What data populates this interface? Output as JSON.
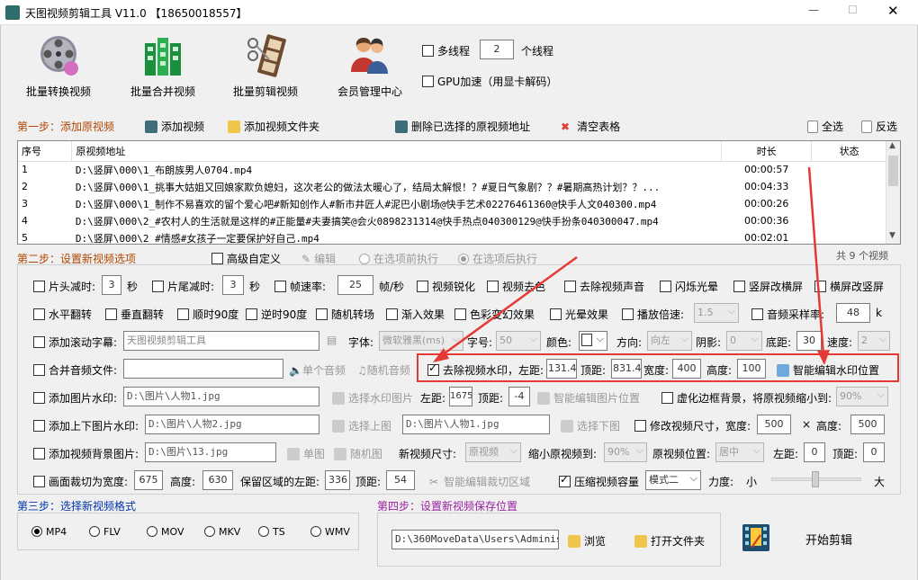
{
  "window": {
    "title": "天图视频剪辑工具 V11.0  【18650018557】",
    "minimize": "—",
    "maximize": "☐",
    "close": "✕"
  },
  "toolbar": {
    "items": [
      {
        "label": "批量转换视频"
      },
      {
        "label": "批量合并视频"
      },
      {
        "label": "批量剪辑视频"
      },
      {
        "label": "会员管理中心"
      }
    ],
    "multithread_label": "多线程",
    "thread_count": "2",
    "thread_unit": "个线程",
    "gpu_label": "GPU加速（用显卡解码）"
  },
  "step1": {
    "title": "第一步：添加原视频",
    "add_video": "添加视频",
    "add_folder": "添加视频文件夹",
    "delete_selected": "删除已选择的原视频地址",
    "clear_table": "清空表格",
    "select_all": "全选",
    "invert": "反选",
    "columns": [
      "序号",
      "原视频地址",
      "时长",
      "状态"
    ],
    "rows": [
      {
        "no": "1",
        "path": "D:\\竖屏\\000\\1_布朗族男人0704.mp4",
        "duration": "00:00:57",
        "status": ""
      },
      {
        "no": "2",
        "path": "D:\\竖屏\\000\\1_挑事大姑姐又回娘家欺负媳妇，这次老公的做法太暖心了，结局太解恨！？#夏日气象剧？？#暑期高热计划？？...",
        "duration": "00:04:33",
        "status": ""
      },
      {
        "no": "3",
        "path": "D:\\竖屏\\000\\1_制作不易喜欢的留个爱心吧#新知创作人#新市井匠人#泥巴小剧场@快手艺术02276461360@快手人文040300.mp4",
        "duration": "00:00:26",
        "status": ""
      },
      {
        "no": "4",
        "path": "D:\\竖屏\\000\\2_#农村人的生活就是这样的#正能量#夫妻搞笑@会火0898231314@快手热点040300129@快手扮条040300047.mp4",
        "duration": "00:00:36",
        "status": ""
      },
      {
        "no": "5",
        "path": "D:\\竖屏\\000\\2_#情感#女孩子一定要保护好自己.mp4",
        "duration": "00:02:01",
        "status": ""
      }
    ],
    "total": "共 9 个视频"
  },
  "step2": {
    "title": "第二步：设置新视频选项",
    "advanced": "高级自定义",
    "edit": "编辑",
    "before": "在选项前执行",
    "after": "在选项后执行",
    "head_trim": "片头减时:",
    "head_val": "3",
    "sec": "秒",
    "tail_trim": "片尾减时:",
    "tail_val": "3",
    "sec2": "秒",
    "fps_label": "帧速率:",
    "fps_val": "25",
    "fps_unit": "帧/秒",
    "sharpen": "视频锐化",
    "decolor": "视频去色",
    "remove_audio": "去除视频声音",
    "flash": "闪烁光晕",
    "v2h": "竖屏改横屏",
    "h2v": "横屏改竖屏",
    "hflip": "水平翻转",
    "vflip": "垂直翻转",
    "rot90cw": "顺时90度",
    "rot90ccw": "逆时90度",
    "random_trans": "随机转场",
    "fade_in": "渐入效果",
    "color_fx": "色彩变幻效果",
    "light_fx": "光晕效果",
    "speed_label": "播放倍速:",
    "speed_val": "1.5",
    "sample_label": "音频采样率:",
    "sample_val": "48",
    "sample_unit": "k",
    "scroll_sub": "添加滚动字幕:",
    "scroll_text": "天图视频剪辑工具",
    "font_label": "字体:",
    "font_val": "微软雅黑(ms)",
    "size_label": "字号:",
    "size_val": "50",
    "color_label": "颜色:",
    "dir_label": "方向:",
    "dir_val": "向左",
    "shadow_label": "阴影:",
    "shadow_val": "0",
    "bottom_label": "底距:",
    "bottom_val": "30",
    "speed2_label": "速度:",
    "speed2_val": "2",
    "merge_audio": "合并音频文件:",
    "single_audio": "单个音频",
    "random_audio": "随机音频",
    "remove_wm": "去除视频水印，左距:",
    "wm_left": "131.4",
    "wm_top_label": "顶距:",
    "wm_top": "831.4",
    "wm_w_label": "宽度:",
    "wm_w": "400",
    "wm_h_label": "高度:",
    "wm_h": "100",
    "smart_wm": "智能编辑水印位置",
    "img_wm": "添加图片水印:",
    "img_wm_path": "D:\\图片\\人物1.jpg",
    "sel_wm_img": "选择水印图片",
    "img_left_label": "左距:",
    "img_left": "1675",
    "img_top_label": "顶距:",
    "img_top": "-4",
    "smart_img": "智能编辑图片位置",
    "blur_bg": "虚化边框背景，将原视频缩小到:",
    "blur_val": "90%",
    "tb_img": "添加上下图片水印:",
    "top_img_path": "D:\\图片\\人物2.jpg",
    "sel_top": "选择上图",
    "bottom_img_path": "D:\\图片\\人物1.jpg",
    "sel_bottom": "选择下图",
    "resize": "修改视频尺寸，宽度:",
    "resize_w": "500",
    "times": "×",
    "resize_h_label": "高度:",
    "resize_h": "500",
    "bg_img": "添加视频背景图片:",
    "bg_path": "D:\\图片\\13.jpg",
    "single_img": "单图",
    "random_img": "随机图",
    "new_size": "新视频尺寸:",
    "new_size_val": "原视频",
    "shrink": "缩小原视频到:",
    "shrink_val": "90%",
    "pos": "原视频位置:",
    "pos_val": "居中",
    "left_label": "左距:",
    "left_val": "0",
    "top_label": "顶距:",
    "top_val": "0",
    "crop": "画面裁切为宽度:",
    "crop_w": "675",
    "crop_h_label": "高度:",
    "crop_h": "630",
    "keep_left": "保留区域的左距:",
    "keep_left_val": "336",
    "keep_top_label": "顶距:",
    "keep_top_val": "54",
    "smart_crop": "智能编辑裁切区域",
    "compress": "压缩视频容量",
    "mode_val": "模式二",
    "strength": "力度:",
    "small": "小",
    "big": "大"
  },
  "step3": {
    "title": "第三步：选择新视频格式",
    "formats": [
      "MP4",
      "FLV",
      "MOV",
      "MKV",
      "TS",
      "WMV"
    ]
  },
  "step4": {
    "title": "第四步：设置新视频保存位置",
    "path": "D:\\360MoveData\\Users\\Administr",
    "browse": "浏览",
    "open_folder": "打开文件夹",
    "start": "开始剪辑"
  },
  "colors": {
    "accent_red": "#e53935",
    "step_orange": "#b34600",
    "step_blue": "#0033aa",
    "step_purple": "#9a1fa0"
  }
}
